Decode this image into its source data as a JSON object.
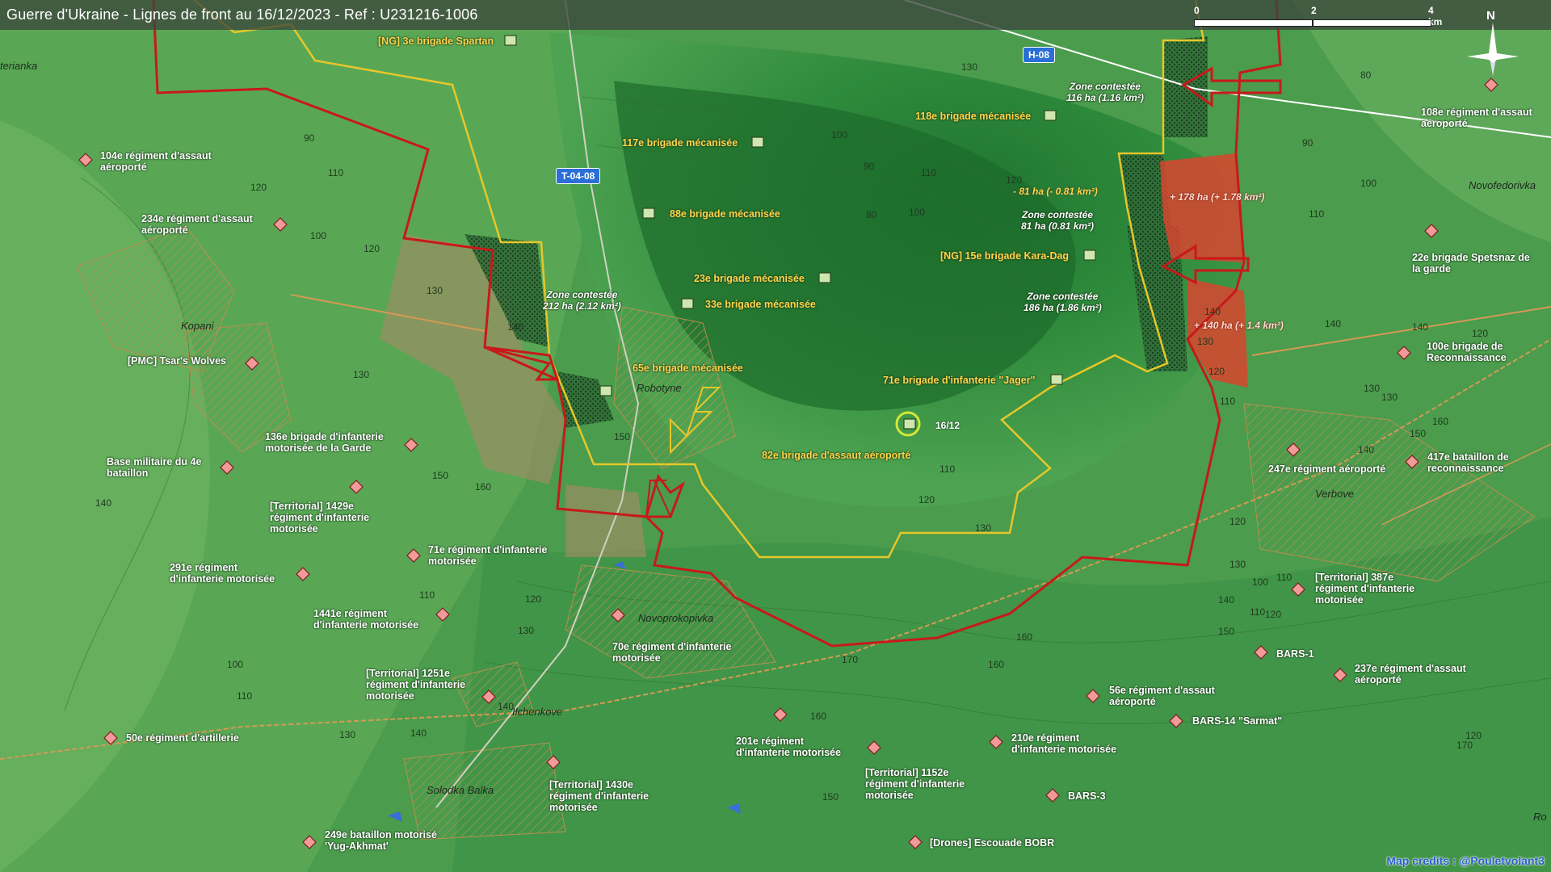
{
  "title": "Guerre d'Ukraine - Lignes de front au 16/12/2023 - Ref : U231216-1006",
  "scale": {
    "t0": "0",
    "t2": "2",
    "t4": "4 km"
  },
  "north_label": "N",
  "roads": {
    "h08": "H-08",
    "t0408": "T-04-08"
  },
  "credits": "Map credits : @Pouletvolant3",
  "towns": {
    "terianka": "terianka",
    "kopani": "Kopani",
    "robotyne": "Robotyne",
    "novoprokopivka": "Novoprokopivka",
    "ilchenkove": "Ilchenkove",
    "solodka_balka": "Solodka Balka",
    "verbove": "Verbove",
    "novofedorivka": "Novofedorivka",
    "ro": "Ro"
  },
  "ukr_units": {
    "ng3": "[NG] 3e brigade Spartan",
    "b117": "117e brigade mécanisée",
    "b118": "118e brigade mécanisée",
    "b88": "88e brigade mécanisée",
    "b23": "23e brigade mécanisée",
    "b33": "33e brigade mécanisée",
    "b65": "65e brigade mécanisée",
    "ng15": "[NG] 15e brigade Kara-Dag",
    "b71": "71e brigade d'infanterie \"Jager\"",
    "b82": "82e brigade d'assaut aéroporté"
  },
  "rus_units": {
    "r104": "104e régiment d'assaut\naéroporté",
    "r234": "234e régiment d'assaut\naéroporté",
    "pmc": "[PMC] Tsar's Wolves",
    "b136": "136e brigade d'infanterie\nmotorisée de la Garde",
    "base4": "Base militaire du 4e\nbataillon",
    "t1429": "[Territorial] 1429e\nrégiment d'infanterie\nmotorisée",
    "r71": "71e régiment d'infanterie\nmotorisée",
    "r291": "291e régiment\nd'infanterie motorisée",
    "r1441": "1441e régiment\nd'infanterie motorisée",
    "r70": "70e régiment d'infanterie\nmotorisée",
    "t1251": "[Territorial] 1251e\nrégiment d'infanterie\nmotorisée",
    "r50": "50e régiment d'artillerie",
    "t1430": "[Territorial] 1430e\nrégiment d'infanterie\nmotorisée",
    "bat249": "249e bataillon motorisé\n'Yug-Akhmat'",
    "r201": "201e régiment\nd'infanterie motorisée",
    "t1152": "[Territorial] 1152e\nrégiment d'infanterie\nmotorisée",
    "r210": "210e régiment\nd'infanterie motorisée",
    "bars3": "BARS-3",
    "bobr": "[Drones] Escouade BOBR",
    "r56": "56e régiment d'assaut\naéroporté",
    "bars14": "BARS-14 \"Sarmat\"",
    "bars1": "BARS-1",
    "r237": "237e régiment d'assaut\naéroporté",
    "t387": "[Territorial] 387e\nrégiment d'infanterie\nmotorisée",
    "r247": "247e régiment aéroporté",
    "bat417": "417e bataillon de\nreconnaissance",
    "b100": "100e brigade de\nReconnaissance",
    "b22": "22e brigade Spetsnaz de\nla garde",
    "r108": "108e régiment d'assaut\naéroporté"
  },
  "zones": {
    "z116": "Zone contestée\n116 ha (1.16 km²)",
    "z81": "Zone contestée\n81 ha (0.81 km²)",
    "z186": "Zone contestée\n186 ha (1.86 km²)",
    "z212": "Zone contestée\n212 ha (2.12 km²)"
  },
  "changes": {
    "loss81": "- 81 ha (- 0.81 km²)",
    "gain178": "+ 178 ha (+ 1.78 km²)",
    "gain140": "+ 140 ha (+ 1.4 km²)"
  },
  "event_date": "16/12",
  "elevations": [
    "90",
    "110",
    "120",
    "100",
    "120",
    "130",
    "140",
    "130",
    "150",
    "150",
    "160",
    "140",
    "110",
    "120",
    "130",
    "100",
    "110",
    "140",
    "130",
    "140",
    "150",
    "160",
    "170",
    "160",
    "160",
    "150",
    "140",
    "130",
    "120",
    "110",
    "120",
    "130",
    "140",
    "100",
    "90",
    "80",
    "100",
    "110",
    "120",
    "130",
    "140",
    "110",
    "120",
    "130",
    "90",
    "100",
    "110",
    "130",
    "80",
    "140",
    "120",
    "130",
    "140",
    "150",
    "160",
    "170",
    "120",
    "110",
    "100",
    "110",
    "120"
  ],
  "colors": {
    "russian_line": "#c8191a",
    "ukrainian_line": "#e6c72a",
    "gain": "#d8452f",
    "contested": "#1f5a2a",
    "title_bg": "#3c463c"
  }
}
